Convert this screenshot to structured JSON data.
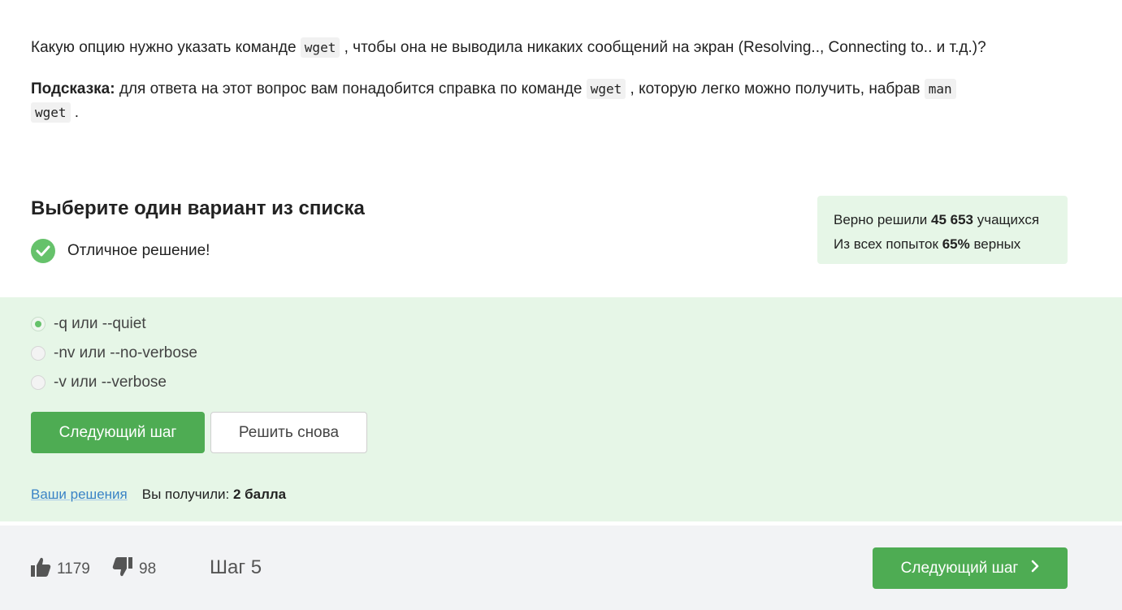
{
  "question": {
    "line1_before": "Какую опцию нужно указать команде ",
    "line1_code": "wget",
    "line1_after": " , чтобы она не выводила никаких сообщений на экран (Resolving.., Connecting to.. и т.д.)?",
    "hint_label": "Подсказка:",
    "hint_before": " для ответа на этот вопрос вам понадобится справка по команде ",
    "hint_code1": "wget",
    "hint_middle": " , которую легко можно получить, набрав ",
    "hint_code2a": "man",
    "hint_code2b": "wget",
    "hint_after": " ."
  },
  "quiz": {
    "title": "Выберите один вариант из списка",
    "success_text": "Отличное решение!",
    "options": [
      {
        "label": "-q или --quiet",
        "selected": true
      },
      {
        "label": "-nv или --no-verbose",
        "selected": false
      },
      {
        "label": "-v или --verbose",
        "selected": false
      }
    ],
    "next_button": "Следующий шаг",
    "retry_button": "Решить снова",
    "solutions_link": "Ваши решения",
    "score_prefix": "Вы получили: ",
    "score_value": "2 балла"
  },
  "stats": {
    "solved_prefix": "Верно решили ",
    "solved_count": "45 653",
    "solved_suffix": " учащихся",
    "attempts_prefix": "Из всех попыток ",
    "attempts_percent": "65%",
    "attempts_suffix": " верных"
  },
  "footer": {
    "likes": "1179",
    "dislikes": "98",
    "step": "Шаг 5",
    "next_button": "Следующий шаг"
  },
  "colors": {
    "accent_green": "#4eac53",
    "panel_green": "#e6f6e7",
    "link_blue": "#3a83c6"
  },
  "icons": [
    "check-circle-icon",
    "thumbs-up-icon",
    "thumbs-down-icon",
    "chevron-right-icon"
  ]
}
